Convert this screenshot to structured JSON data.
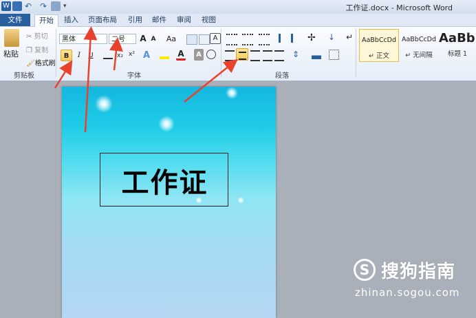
{
  "window": {
    "title": "工作证.docx - Microsoft Word"
  },
  "tabs": [
    "文件",
    "开始",
    "插入",
    "页面布局",
    "引用",
    "邮件",
    "审阅",
    "视图"
  ],
  "clipboard": {
    "paste": "粘贴",
    "cut": "剪切",
    "copy": "复制",
    "format_painter": "格式刷",
    "group": "剪贴板"
  },
  "font": {
    "name": "黑体",
    "size": "二号",
    "group": "字体",
    "bold": "B",
    "italic": "I",
    "underline": "U",
    "grow": "A",
    "shrink": "A",
    "change_case": "Aa",
    "clear": "A",
    "color_a": "A",
    "char_shade": "A"
  },
  "paragraph": {
    "group": "段落"
  },
  "styles": [
    {
      "sample": "AaBbCcDd",
      "name": "↵ 正文"
    },
    {
      "sample": "AaBbCcDd",
      "name": "↵ 无间隔"
    },
    {
      "sample": "AaBb",
      "name": "标题 1"
    }
  ],
  "document": {
    "title": "工作证"
  },
  "watermark": {
    "logo": "S",
    "name": "搜狗指南",
    "url": "zhinan.sogou.com"
  },
  "colors": {
    "file_tab": "#2a5f9e",
    "arrow": "#e8412c",
    "highlight": "#f7c857"
  }
}
